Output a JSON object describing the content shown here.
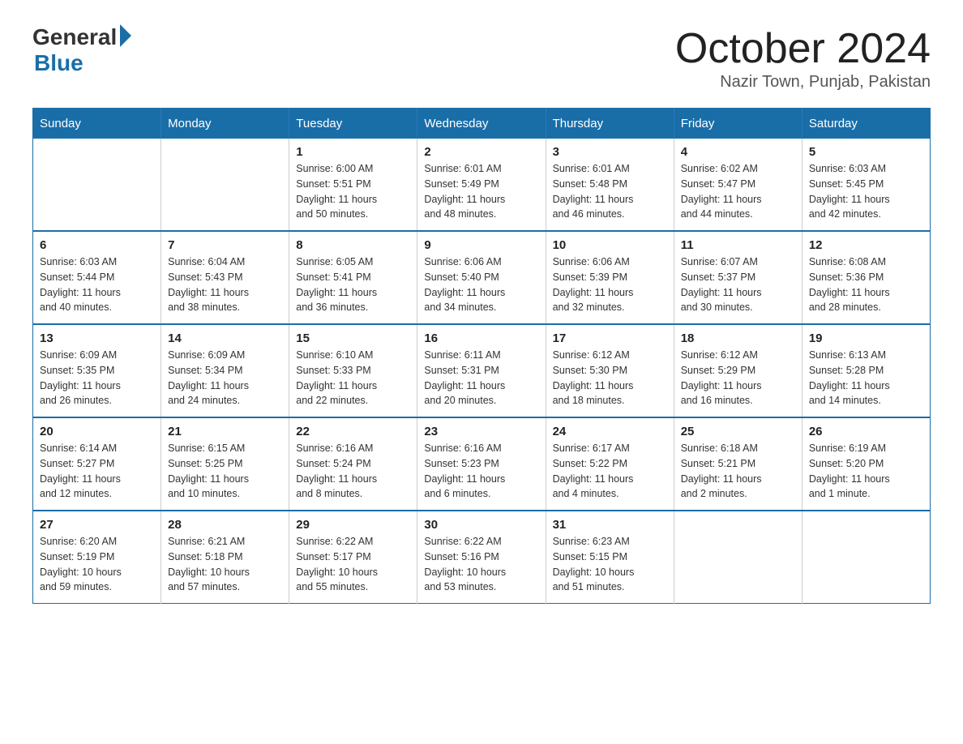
{
  "logo": {
    "general": "General",
    "blue": "Blue"
  },
  "title": {
    "month": "October 2024",
    "location": "Nazir Town, Punjab, Pakistan"
  },
  "days_of_week": [
    "Sunday",
    "Monday",
    "Tuesday",
    "Wednesday",
    "Thursday",
    "Friday",
    "Saturday"
  ],
  "weeks": [
    [
      {
        "day": "",
        "info": ""
      },
      {
        "day": "",
        "info": ""
      },
      {
        "day": "1",
        "info": "Sunrise: 6:00 AM\nSunset: 5:51 PM\nDaylight: 11 hours\nand 50 minutes."
      },
      {
        "day": "2",
        "info": "Sunrise: 6:01 AM\nSunset: 5:49 PM\nDaylight: 11 hours\nand 48 minutes."
      },
      {
        "day": "3",
        "info": "Sunrise: 6:01 AM\nSunset: 5:48 PM\nDaylight: 11 hours\nand 46 minutes."
      },
      {
        "day": "4",
        "info": "Sunrise: 6:02 AM\nSunset: 5:47 PM\nDaylight: 11 hours\nand 44 minutes."
      },
      {
        "day": "5",
        "info": "Sunrise: 6:03 AM\nSunset: 5:45 PM\nDaylight: 11 hours\nand 42 minutes."
      }
    ],
    [
      {
        "day": "6",
        "info": "Sunrise: 6:03 AM\nSunset: 5:44 PM\nDaylight: 11 hours\nand 40 minutes."
      },
      {
        "day": "7",
        "info": "Sunrise: 6:04 AM\nSunset: 5:43 PM\nDaylight: 11 hours\nand 38 minutes."
      },
      {
        "day": "8",
        "info": "Sunrise: 6:05 AM\nSunset: 5:41 PM\nDaylight: 11 hours\nand 36 minutes."
      },
      {
        "day": "9",
        "info": "Sunrise: 6:06 AM\nSunset: 5:40 PM\nDaylight: 11 hours\nand 34 minutes."
      },
      {
        "day": "10",
        "info": "Sunrise: 6:06 AM\nSunset: 5:39 PM\nDaylight: 11 hours\nand 32 minutes."
      },
      {
        "day": "11",
        "info": "Sunrise: 6:07 AM\nSunset: 5:37 PM\nDaylight: 11 hours\nand 30 minutes."
      },
      {
        "day": "12",
        "info": "Sunrise: 6:08 AM\nSunset: 5:36 PM\nDaylight: 11 hours\nand 28 minutes."
      }
    ],
    [
      {
        "day": "13",
        "info": "Sunrise: 6:09 AM\nSunset: 5:35 PM\nDaylight: 11 hours\nand 26 minutes."
      },
      {
        "day": "14",
        "info": "Sunrise: 6:09 AM\nSunset: 5:34 PM\nDaylight: 11 hours\nand 24 minutes."
      },
      {
        "day": "15",
        "info": "Sunrise: 6:10 AM\nSunset: 5:33 PM\nDaylight: 11 hours\nand 22 minutes."
      },
      {
        "day": "16",
        "info": "Sunrise: 6:11 AM\nSunset: 5:31 PM\nDaylight: 11 hours\nand 20 minutes."
      },
      {
        "day": "17",
        "info": "Sunrise: 6:12 AM\nSunset: 5:30 PM\nDaylight: 11 hours\nand 18 minutes."
      },
      {
        "day": "18",
        "info": "Sunrise: 6:12 AM\nSunset: 5:29 PM\nDaylight: 11 hours\nand 16 minutes."
      },
      {
        "day": "19",
        "info": "Sunrise: 6:13 AM\nSunset: 5:28 PM\nDaylight: 11 hours\nand 14 minutes."
      }
    ],
    [
      {
        "day": "20",
        "info": "Sunrise: 6:14 AM\nSunset: 5:27 PM\nDaylight: 11 hours\nand 12 minutes."
      },
      {
        "day": "21",
        "info": "Sunrise: 6:15 AM\nSunset: 5:25 PM\nDaylight: 11 hours\nand 10 minutes."
      },
      {
        "day": "22",
        "info": "Sunrise: 6:16 AM\nSunset: 5:24 PM\nDaylight: 11 hours\nand 8 minutes."
      },
      {
        "day": "23",
        "info": "Sunrise: 6:16 AM\nSunset: 5:23 PM\nDaylight: 11 hours\nand 6 minutes."
      },
      {
        "day": "24",
        "info": "Sunrise: 6:17 AM\nSunset: 5:22 PM\nDaylight: 11 hours\nand 4 minutes."
      },
      {
        "day": "25",
        "info": "Sunrise: 6:18 AM\nSunset: 5:21 PM\nDaylight: 11 hours\nand 2 minutes."
      },
      {
        "day": "26",
        "info": "Sunrise: 6:19 AM\nSunset: 5:20 PM\nDaylight: 11 hours\nand 1 minute."
      }
    ],
    [
      {
        "day": "27",
        "info": "Sunrise: 6:20 AM\nSunset: 5:19 PM\nDaylight: 10 hours\nand 59 minutes."
      },
      {
        "day": "28",
        "info": "Sunrise: 6:21 AM\nSunset: 5:18 PM\nDaylight: 10 hours\nand 57 minutes."
      },
      {
        "day": "29",
        "info": "Sunrise: 6:22 AM\nSunset: 5:17 PM\nDaylight: 10 hours\nand 55 minutes."
      },
      {
        "day": "30",
        "info": "Sunrise: 6:22 AM\nSunset: 5:16 PM\nDaylight: 10 hours\nand 53 minutes."
      },
      {
        "day": "31",
        "info": "Sunrise: 6:23 AM\nSunset: 5:15 PM\nDaylight: 10 hours\nand 51 minutes."
      },
      {
        "day": "",
        "info": ""
      },
      {
        "day": "",
        "info": ""
      }
    ]
  ]
}
